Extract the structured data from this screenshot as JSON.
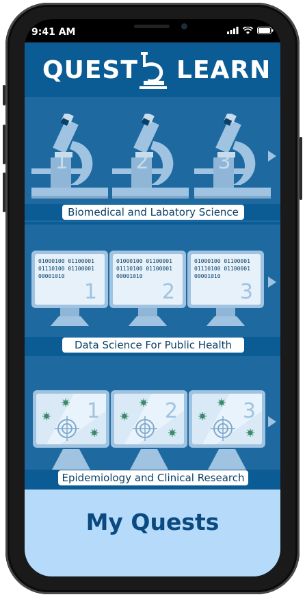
{
  "status": {
    "time": "9:41 AM"
  },
  "app": {
    "logo_left": "QUEST",
    "logo_right": "LEARN"
  },
  "sections": [
    {
      "label": "Biomedical and Labatory Science",
      "tiles": [
        "1",
        "2",
        "3"
      ]
    },
    {
      "label": "Data Science For Public Health",
      "tiles": [
        "1",
        "2",
        "3"
      ],
      "binary": [
        "01000100 01100001",
        "01110100 01100001",
        "00001010"
      ]
    },
    {
      "label": "Epidemiology and Clinical Research",
      "tiles": [
        "1",
        "2",
        "3"
      ]
    }
  ],
  "footer": {
    "title": "My Quests"
  },
  "icons": {
    "next": "chevron-right-icon",
    "microscope": "microscope-icon",
    "monitor": "monitor-icon",
    "target": "crosshair-icon",
    "virus": "virus-icon"
  },
  "colors": {
    "header_bg": "#0b5c94",
    "section_bg": "#1e6aa0",
    "footer_bg": "#b6dafa",
    "footer_text": "#0b4a80"
  }
}
